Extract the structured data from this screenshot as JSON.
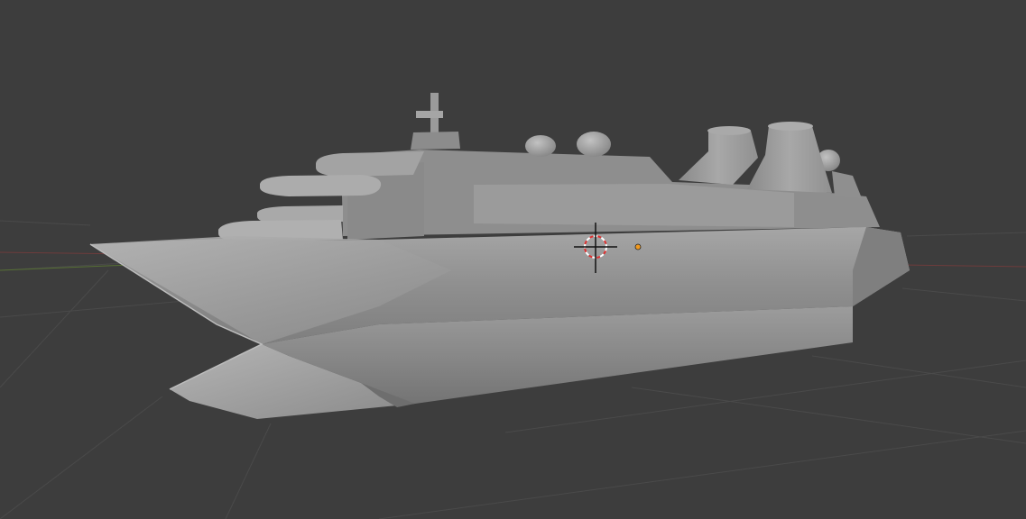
{
  "app": {
    "view": "3d-viewport",
    "shading": "solid",
    "colors": {
      "background": "#3d3d3d",
      "grid_line": "#4a4a4a",
      "x_axis": "#8a3b3b",
      "y_axis": "#5c7d2e",
      "model_base": "#8f8f8f",
      "cursor_ring_red": "#e03030",
      "cursor_ring_white": "#ffffff",
      "origin_dot": "#f29a1f"
    }
  },
  "scene": {
    "object": "cruise-ship-mesh",
    "cursor": "3d-cursor",
    "origin": "object-origin"
  }
}
